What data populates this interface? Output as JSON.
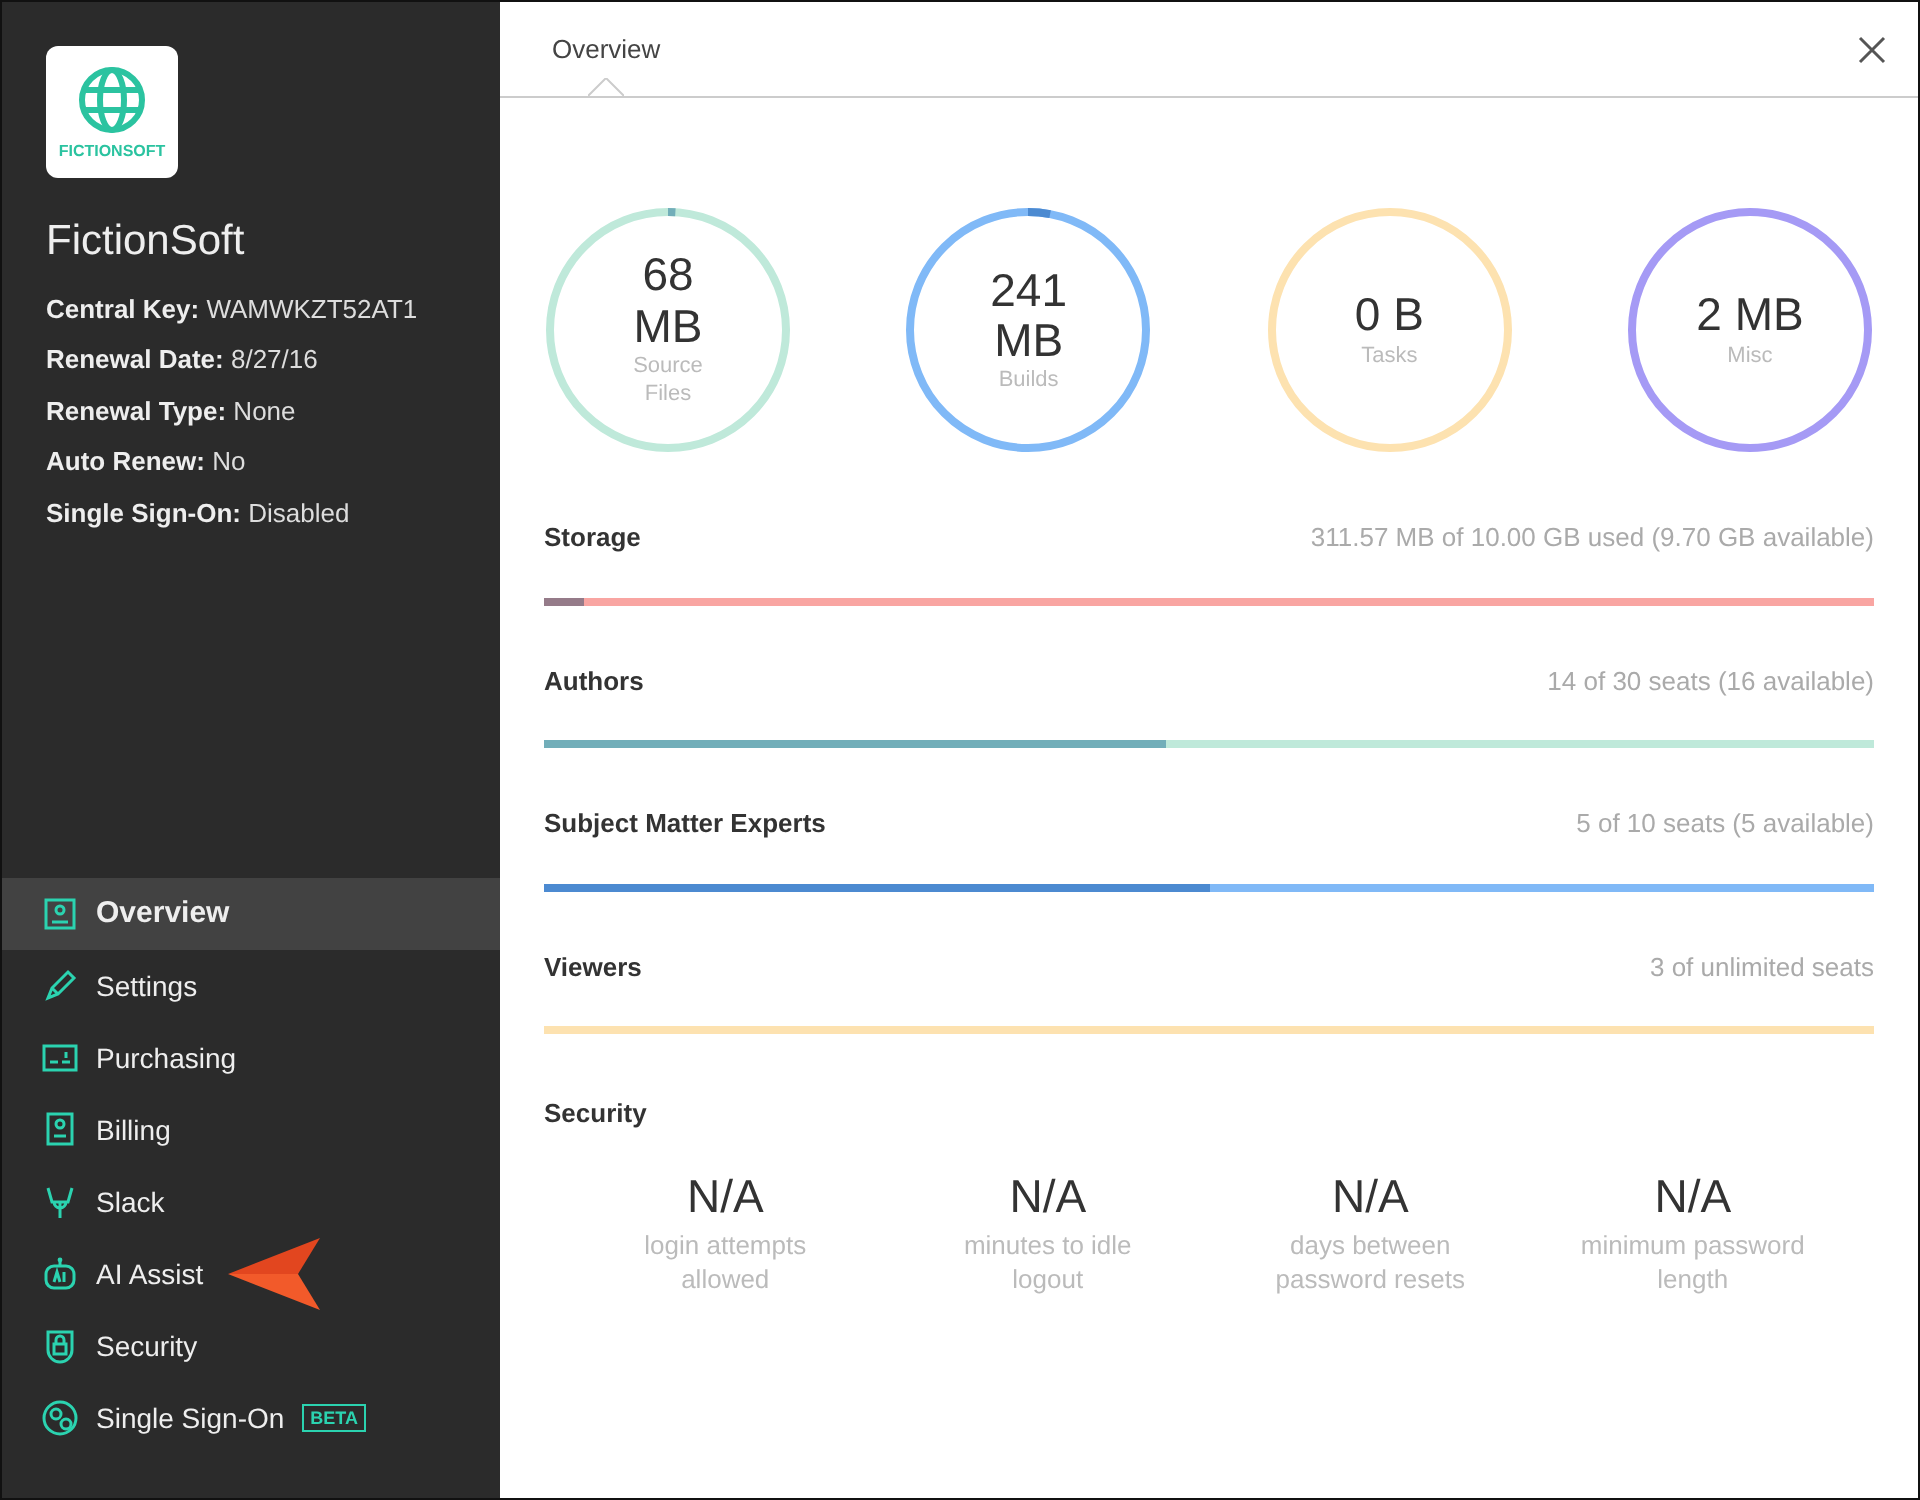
{
  "sidebar": {
    "logo_text": "FICTIONSOFT",
    "org_name": "FictionSoft",
    "details": [
      "**Central Key:** WAMWKZT52AT1",
      "**Renewal Date:** 8/27/16",
      "**Renewal Type:** None",
      "**Auto Renew:** No",
      "**Single Sign-On:** Disabled"
    ],
    "nav": [
      {
        "label": "Overview",
        "selected": true
      },
      {
        "label": "Settings",
        "selected": false
      },
      {
        "label": "Purchasing",
        "selected": false
      },
      {
        "label": "Billing",
        "selected": false
      },
      {
        "label": "Slack",
        "selected": false
      },
      {
        "label": "AI Assist",
        "selected": false,
        "pointer": true
      },
      {
        "label": "Security",
        "selected": false
      },
      {
        "label": "Single Sign-On",
        "selected": false,
        "badge": "BETA"
      }
    ]
  },
  "tabs": [
    {
      "label": "Overview",
      "selected": true
    }
  ],
  "rings": [
    {
      "value": "68 MB",
      "label": "Source Files",
      "color": "#bfe9da",
      "level": 0.01
    },
    {
      "value": "241 MB",
      "label": "Builds",
      "color": "#80b9f7",
      "level": 0.03
    },
    {
      "value": "0 B",
      "label": "Tasks",
      "color": "#fde2b0"
    },
    {
      "value": "2 MB",
      "label": "Misc",
      "color": "#a59af5"
    }
  ],
  "usage": [
    {
      "title": "Storage",
      "summary": "311.57 MB of 10.00 GB used (9.70 GB available)",
      "color": "#f9a5a2",
      "level": 0.03
    },
    {
      "title": "Authors",
      "summary": "14 of 30 seats (16 available)",
      "color": "#bfe9da",
      "level": 0.467
    },
    {
      "title": "Subject Matter Experts",
      "summary": "5 of 10 seats (5 available)",
      "color": "#80b9f7",
      "level": 0.5
    },
    {
      "title": "Viewers",
      "summary": "3 of unlimited seats",
      "color": "#fde2b0",
      "level": 0
    }
  ],
  "security": {
    "title": "Security",
    "stats": [
      {
        "value": "N/A",
        "label": "login attempts allowed"
      },
      {
        "value": "N/A",
        "label": "minutes to idle logout"
      },
      {
        "value": "N/A",
        "label": "days between password resets"
      },
      {
        "value": "N/A",
        "label": "minimum password length"
      }
    ]
  }
}
